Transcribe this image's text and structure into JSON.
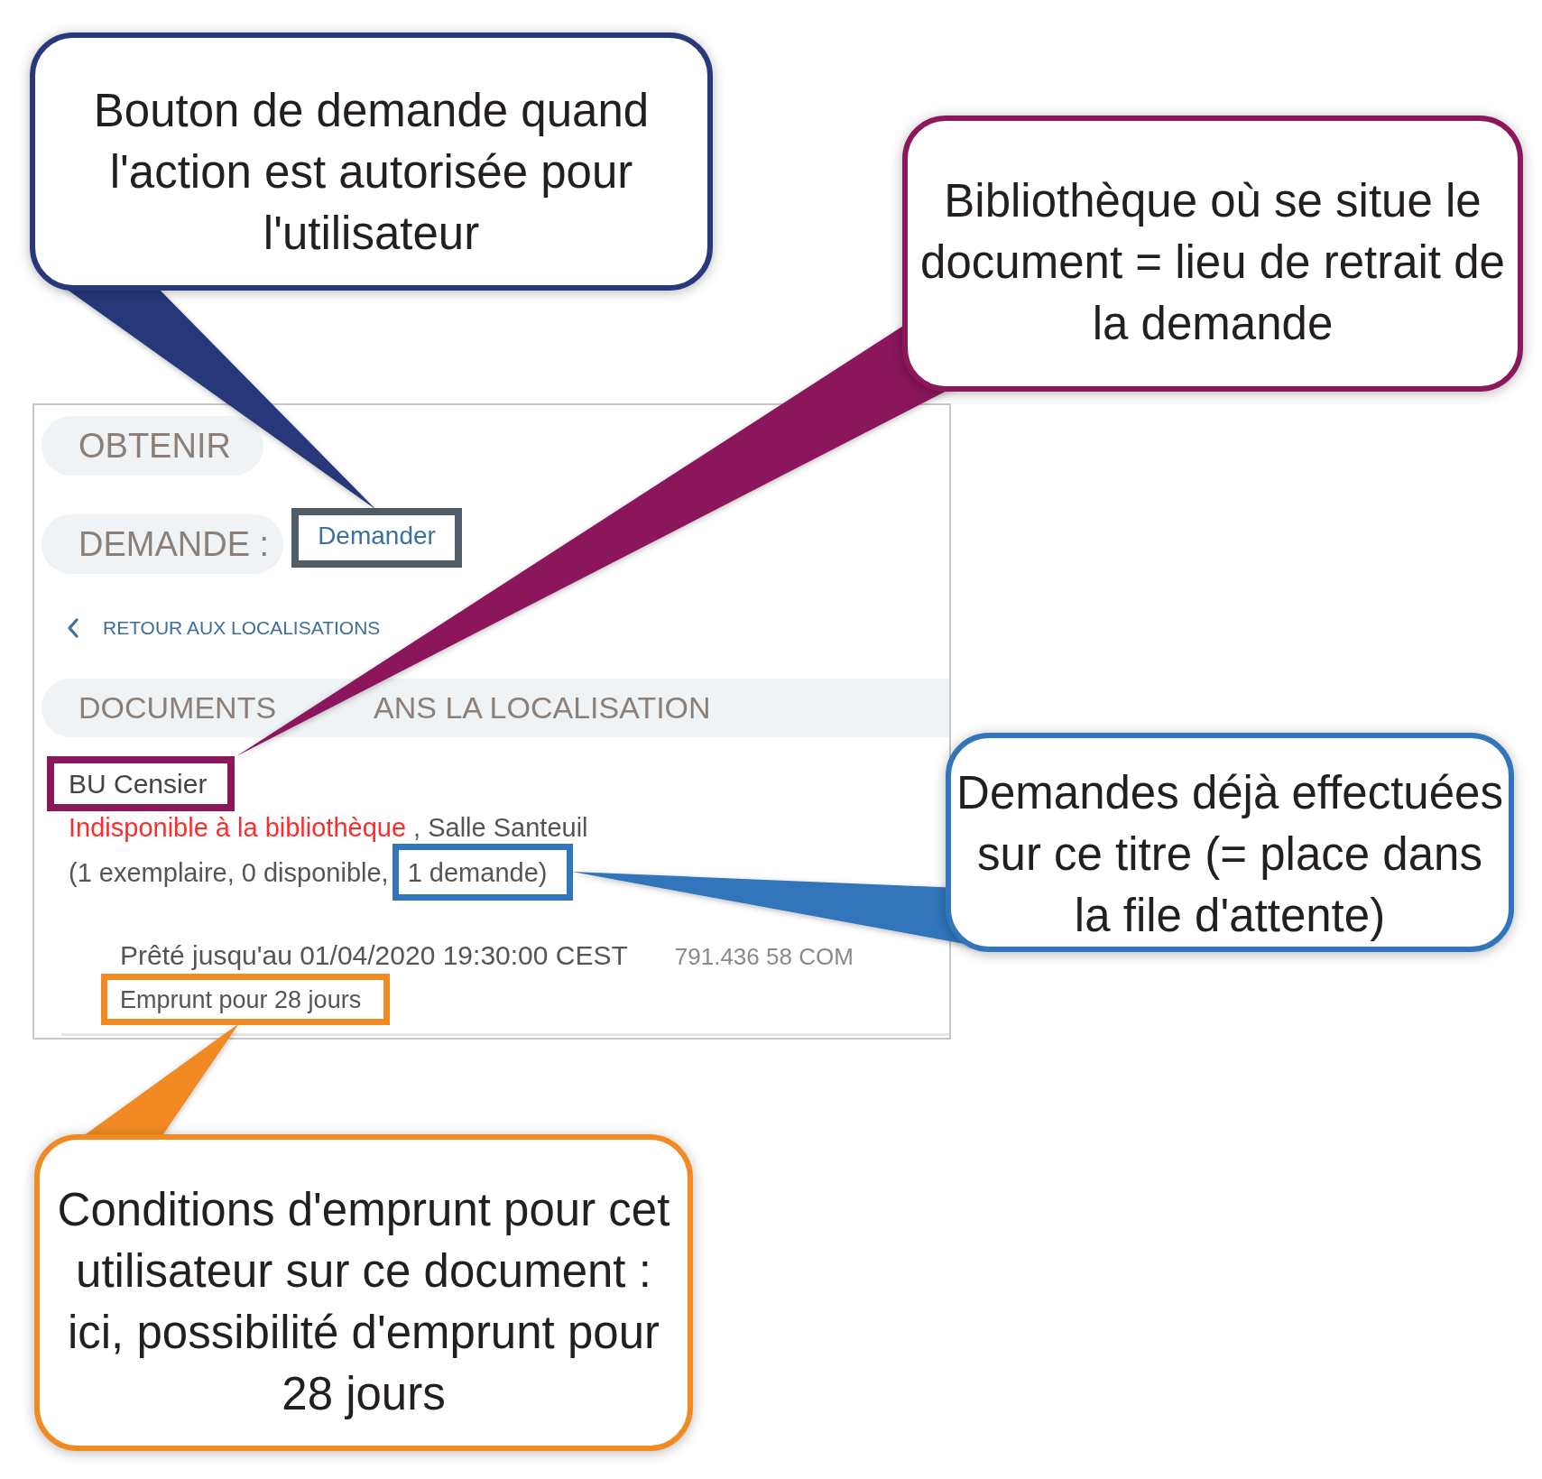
{
  "panel": {
    "obtain_heading": "OBTENIR",
    "request_label": "DEMANDE :",
    "request_button": "Demander",
    "back_link": "RETOUR AUX LOCALISATIONS",
    "location_heading": [
      "DOCUMENTS",
      "ANS LA LOCALISATION"
    ],
    "holding": {
      "library": "BU Censier",
      "status": "Indisponible à la bibliothèque",
      "available": false,
      "shelf": ", Salle Santeuil",
      "copies": "(1 exemplaire, 0 disponible,",
      "requests": "1 demande)"
    },
    "item": {
      "due": "Prêté jusqu'au 01/04/2020 19:30:00 CEST",
      "call_number": "791.436 58 COM",
      "policy": "Emprunt pour 28 jours"
    }
  },
  "callouts": [
    {
      "kind": "request",
      "text": "Bouton de demande quand\nl'action est autorisée pour\nl'utilisateur",
      "color": "#27397a",
      "frame": {
        "color": "#4e5d67"
      }
    },
    {
      "kind": "library",
      "text": "Bibliothèque où se situe le\ndocument = lieu de retrait de\nla demande",
      "color": "#8b185b",
      "frame": {
        "color": "#8b185b"
      }
    },
    {
      "kind": "requests",
      "text": "Demandes déjà effectuées\nsur ce titre (= place dans\nla file d'attente)",
      "color": "#3175bb",
      "frame": {
        "color": "#3175bb"
      }
    },
    {
      "kind": "policy",
      "text": "Conditions d'emprunt pour cet\nutilisateur sur ce document :\nici, possibilité d'emprunt pour\n28 jours",
      "color": "#f18a21",
      "frame": {
        "color": "#f18a21"
      }
    }
  ]
}
